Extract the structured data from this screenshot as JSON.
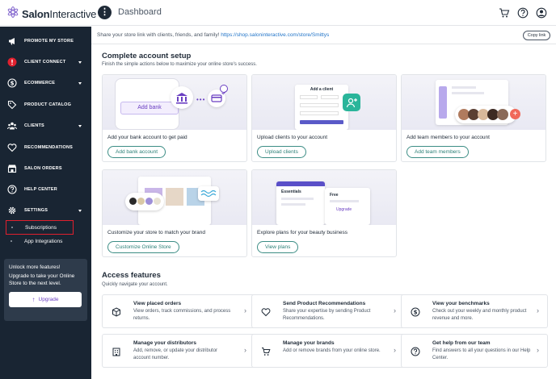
{
  "brand": {
    "name_bold": "Salon",
    "name_regular": "Interactive"
  },
  "topbar": {
    "menu_glyph": "⋮",
    "title": "Dashboard",
    "icons": [
      "cart-icon",
      "help-icon",
      "account-icon"
    ]
  },
  "sidebar": {
    "items": [
      {
        "label": "PROMOTE MY STORE",
        "icon": "megaphone-icon"
      },
      {
        "label": "CLIENT CONNECT",
        "icon": "alert-icon",
        "caret": true
      },
      {
        "label": "ECOMMERCE",
        "icon": "dollar-icon",
        "caret": true
      },
      {
        "label": "PRODUCT CATALOG",
        "icon": "tag-icon"
      },
      {
        "label": "CLIENTS",
        "icon": "clients-icon",
        "caret": true
      },
      {
        "label": "RECOMMENDATIONS",
        "icon": "heart-icon"
      },
      {
        "label": "SALON ORDERS",
        "icon": "store-icon"
      },
      {
        "label": "HELP CENTER",
        "icon": "help-icon"
      },
      {
        "label": "SETTINGS",
        "icon": "settings-icon",
        "caret": true
      }
    ],
    "subitems": [
      {
        "label": "Subscriptions",
        "active": true
      },
      {
        "label": "App Integrations",
        "active": false
      }
    ],
    "upgrade": {
      "title": "Unlock more features!",
      "text": "Upgrade to take your Online Store to the next level.",
      "button": "Upgrade"
    }
  },
  "share": {
    "text": "Share your store link with clients, friends, and family!",
    "link": "https://shop.saloninteractive.com/store/Smittys",
    "copy": "Copy link"
  },
  "setup": {
    "title": "Complete account setup",
    "subtitle": "Finish the simple actions below to maximize your online store's success.",
    "cards": [
      {
        "caption": "Add your bank account to get paid",
        "button": "Add bank account",
        "illus_label": "Add bank"
      },
      {
        "caption": "Upload clients to your account",
        "button": "Upload clients",
        "illus_label": "Add a client"
      },
      {
        "caption": "Add team members to your account",
        "button": "Add team members"
      },
      {
        "caption": "Customize your store to match your brand",
        "button": "Customize Online Store"
      },
      {
        "caption": "Explore plans for your beauty business",
        "button": "View plans",
        "illus_plan_a": "Essentials",
        "illus_plan_b": "Free",
        "illus_upgrade": "Upgrade"
      }
    ]
  },
  "access": {
    "title": "Access features",
    "subtitle": "Quickly navigate your account.",
    "items": [
      {
        "title": "View placed orders",
        "desc": "View orders, track commissions, and process returns.",
        "icon": "box-icon"
      },
      {
        "title": "Send Product Recommendations",
        "desc": "Share your expertise by sending Product Recommendations.",
        "icon": "heart-icon"
      },
      {
        "title": "View your benchmarks",
        "desc": "Check out your weekly and monthly product revenue and more.",
        "icon": "dollar-icon"
      },
      {
        "title": "Manage your distributors",
        "desc": "Add, remove, or update your distributor account number.",
        "icon": "building-icon"
      },
      {
        "title": "Manage your brands",
        "desc": "Add or remove brands from your online store.",
        "icon": "cart-icon"
      },
      {
        "title": "Get help from our team",
        "desc": "Find answers to all your questions in our Help Center.",
        "icon": "help-icon"
      }
    ]
  },
  "colors": {
    "sidebar": "#192533",
    "accent_teal": "#3c8d85",
    "link": "#2476c9",
    "purple": "#6a3fc2",
    "active_outline": "#e0202e"
  }
}
